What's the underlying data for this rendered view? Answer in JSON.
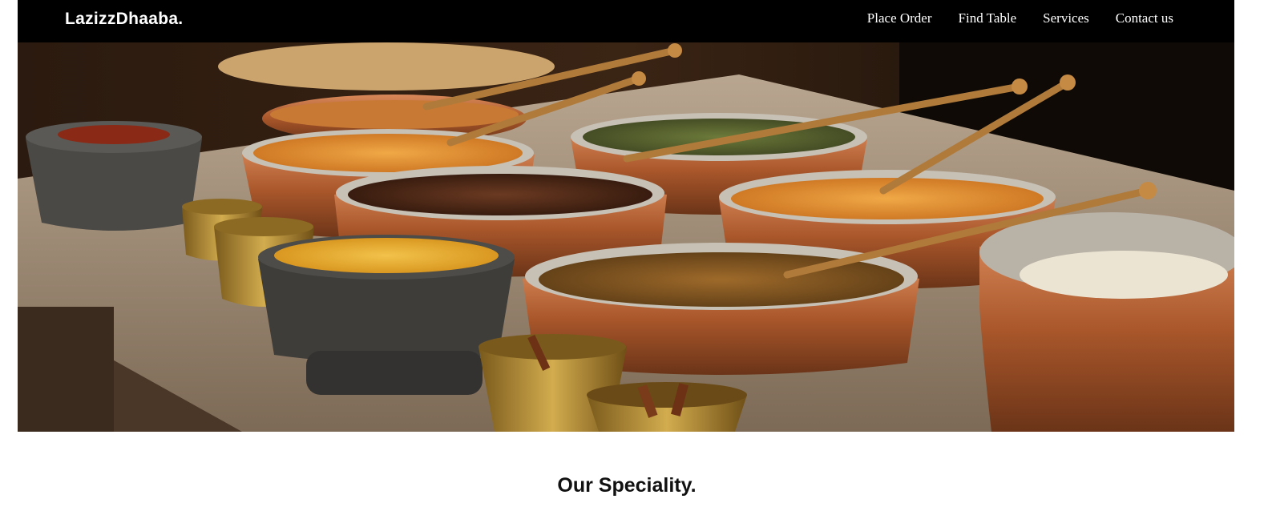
{
  "navbar": {
    "brand": "LazizzDhaaba.",
    "links": [
      "Place Order",
      "Find Table",
      "Services",
      "Contact us"
    ]
  },
  "hero": {
    "image_subject": "Indian dishes in copper bowls on a stone counter"
  },
  "main": {
    "section_title": "Our Speciality."
  },
  "colors": {
    "navbar_bg": "#000000",
    "nav_text": "#ffffff",
    "copper": "#b0622f",
    "curry": "#e08a2c",
    "turmeric": "#e2a629"
  }
}
